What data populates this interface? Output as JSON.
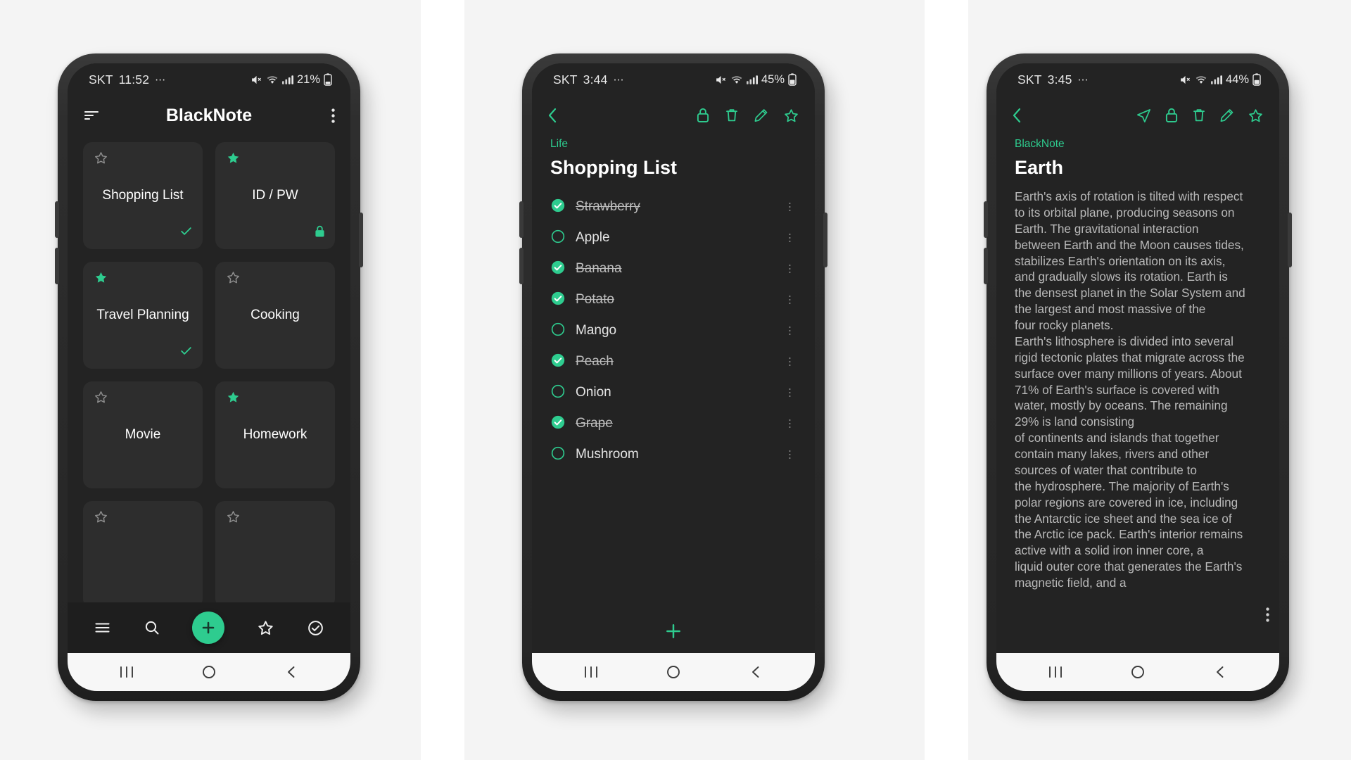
{
  "accent": "#2ecc8f",
  "background": "#f4f4f4",
  "phones": [
    {
      "id": "phone-home",
      "status": {
        "carrier": "SKT",
        "time": "11:52",
        "dots": "⋯",
        "battery": "21%",
        "icons": [
          "mute-icon",
          "wifi-icon",
          "signal-icon",
          "battery-icon"
        ]
      },
      "appbar": {
        "menu_icon": "sort-menu-icon",
        "title": "BlackNote",
        "overflow_icon": "kebab-menu-icon"
      },
      "notes": [
        {
          "title": "Shopping List",
          "starred": false,
          "badge": "check"
        },
        {
          "title": "ID / PW",
          "starred": true,
          "badge": "lock"
        },
        {
          "title": "Travel Planning",
          "starred": true,
          "badge": "check"
        },
        {
          "title": "Cooking",
          "starred": false,
          "badge": ""
        },
        {
          "title": "Movie",
          "starred": false,
          "badge": ""
        },
        {
          "title": "Homework",
          "starred": true,
          "badge": ""
        },
        {
          "title": "",
          "starred": false,
          "badge": ""
        },
        {
          "title": "",
          "starred": false,
          "badge": ""
        }
      ],
      "toolbar": [
        {
          "name": "list-menu-icon",
          "label": "Menu"
        },
        {
          "name": "search-icon",
          "label": "Search"
        },
        {
          "name": "add-note-fab",
          "label": "Add"
        },
        {
          "name": "favorites-star-icon",
          "label": "Favorites"
        },
        {
          "name": "checklist-icon",
          "label": "Checklist"
        }
      ]
    },
    {
      "id": "phone-checklist",
      "status": {
        "carrier": "SKT",
        "time": "3:44",
        "dots": "⋯",
        "battery": "45%",
        "icons": [
          "mute-icon",
          "wifi-icon",
          "signal-icon",
          "battery-icon"
        ]
      },
      "appbar": {
        "back_icon": "back-chevron-icon",
        "actions": [
          "lock-icon",
          "delete-trash-icon",
          "edit-pencil-icon",
          "star-outline-icon"
        ]
      },
      "category": "Life",
      "title": "Shopping List",
      "items": [
        {
          "label": "Strawberry",
          "checked": true
        },
        {
          "label": "Apple",
          "checked": false
        },
        {
          "label": "Banana",
          "checked": true
        },
        {
          "label": "Potato",
          "checked": true
        },
        {
          "label": "Mango",
          "checked": false
        },
        {
          "label": "Peach",
          "checked": true
        },
        {
          "label": "Onion",
          "checked": false
        },
        {
          "label": "Grape",
          "checked": true
        },
        {
          "label": "Mushroom",
          "checked": false
        }
      ],
      "add_icon": "add-plus-icon"
    },
    {
      "id": "phone-note",
      "status": {
        "carrier": "SKT",
        "time": "3:45",
        "dots": "⋯",
        "battery": "44%",
        "icons": [
          "mute-icon",
          "wifi-icon",
          "signal-icon",
          "battery-icon"
        ]
      },
      "appbar": {
        "back_icon": "back-chevron-icon",
        "actions": [
          "share-send-icon",
          "lock-icon",
          "delete-trash-icon",
          "edit-pencil-icon",
          "star-outline-icon"
        ]
      },
      "category": "BlackNote",
      "title": "Earth",
      "body": "Earth's axis of rotation is tilted with respect\nto its orbital plane, producing seasons on\nEarth. The gravitational interaction\nbetween Earth and the Moon causes tides,\nstabilizes Earth's orientation on its axis,\nand gradually slows its rotation. Earth is\nthe densest planet in the Solar System and\nthe largest and most massive of the\nfour rocky planets.\nEarth's lithosphere is divided into several\nrigid tectonic plates that migrate across the\nsurface over many millions of years. About\n71% of Earth's surface is covered with\nwater, mostly by oceans. The remaining\n29% is land consisting\nof continents and islands that together\ncontain many lakes, rivers and other\nsources of water that contribute to\nthe hydrosphere. The majority of Earth's\npolar regions are covered in ice, including\nthe Antarctic ice sheet and the sea ice of\nthe Arctic ice pack. Earth's interior remains\nactive with a solid iron inner core, a\nliquid outer core that generates the Earth's\nmagnetic field, and a",
      "overflow_icon": "kebab-menu-icon"
    }
  ],
  "android_nav": {
    "recents": "recents-icon",
    "home": "home-icon",
    "back": "back-icon"
  }
}
